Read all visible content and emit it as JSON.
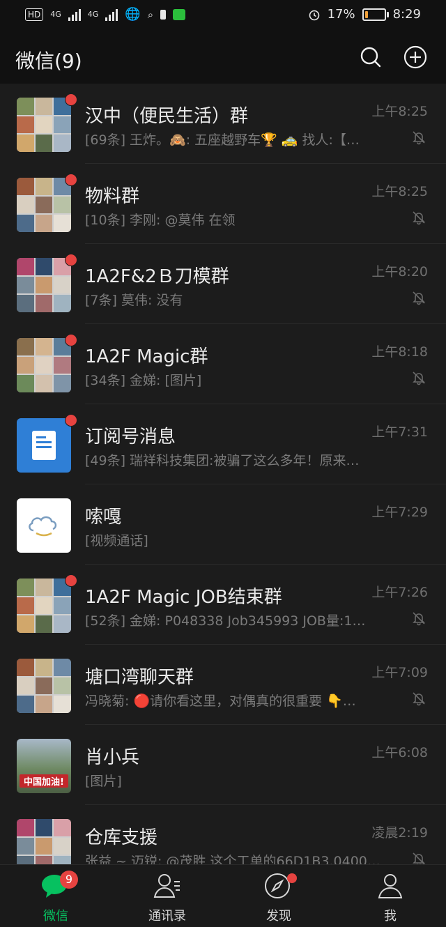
{
  "status_bar": {
    "hd_label": "HD",
    "sim_label": "4G",
    "alarm_icon": "alarm-icon",
    "battery_percent": "17%",
    "battery_level": 0.17,
    "time": "8:29"
  },
  "header": {
    "title": "微信(9)",
    "search_icon": "search-icon",
    "add_icon": "plus-circle-icon"
  },
  "chats": [
    {
      "name": "汉中（便民生活）群",
      "time": "上午8:25",
      "preview": "[69条] 王炸。🙈: 五座越野车🏆  🚕 找人:【…",
      "unread_dot": true,
      "muted": true,
      "avatar": "group"
    },
    {
      "name": "物料群",
      "time": "上午8:25",
      "preview": "[10条] 李刚: @莫伟 在领",
      "unread_dot": true,
      "muted": true,
      "avatar": "group"
    },
    {
      "name": "1A2F&2Ｂ刀模群",
      "time": "上午8:20",
      "preview": "[7条] 莫伟: 没有",
      "unread_dot": true,
      "muted": true,
      "avatar": "group"
    },
    {
      "name": "1A2F Magic群",
      "time": "上午8:18",
      "preview": "[34条] 金娣: [图片]",
      "unread_dot": true,
      "muted": true,
      "avatar": "group"
    },
    {
      "name": "订阅号消息",
      "time": "上午7:31",
      "preview": "[49条] 瑞祥科技集团:被骗了这么多年！原来…",
      "unread_dot": true,
      "muted": false,
      "avatar": "subscription"
    },
    {
      "name": "嗦嘎",
      "time": "上午7:29",
      "preview": "[视频通话]",
      "unread_dot": false,
      "muted": false,
      "avatar": "cloud"
    },
    {
      "name": "1A2F Magic JOB结束群",
      "time": "上午7:26",
      "preview": "[52条] 金娣:  P048338     Job345993 JOB量:1…",
      "unread_dot": true,
      "muted": true,
      "avatar": "group"
    },
    {
      "name": "塘口湾聊天群",
      "time": "上午7:09",
      "preview": "冯晓菊: 🔴请你看这里，对偶真的很重要 👇…",
      "unread_dot": false,
      "muted": true,
      "avatar": "group"
    },
    {
      "name": "肖小兵",
      "time": "上午6:08",
      "preview": "[图片]",
      "unread_dot": false,
      "muted": false,
      "avatar": "photo",
      "avatar_caption": "中国加油!"
    },
    {
      "name": "仓库支援",
      "time": "凌晨2:19",
      "preview": "张益 ~ 迈锐: @茂胜 这个工单的66D1B3.0400…",
      "unread_dot": false,
      "muted": true,
      "avatar": "group"
    }
  ],
  "tabs": [
    {
      "label": "微信",
      "icon": "chat-bubble-icon",
      "badge": "9",
      "active": true
    },
    {
      "label": "通讯录",
      "icon": "contacts-icon",
      "badge": "",
      "active": false
    },
    {
      "label": "发现",
      "icon": "compass-icon",
      "badge": "",
      "dot": true,
      "active": false
    },
    {
      "label": "我",
      "icon": "person-icon",
      "badge": "",
      "active": false
    }
  ],
  "colors": {
    "accent": "#07c160",
    "badge": "#e64340",
    "background": "#1c1c1c"
  }
}
